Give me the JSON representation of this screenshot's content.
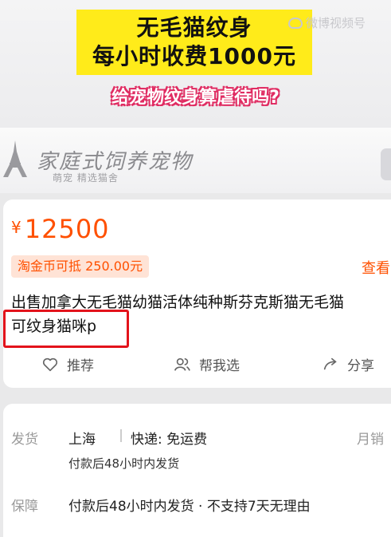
{
  "overlay": {
    "headline_lines": [
      "无毛猫纹身",
      "每小时收费1000元"
    ],
    "subheadline": "给宠物纹身算虐待吗?",
    "watermark": "微博视频号"
  },
  "shop_banner": {
    "title": "家庭式饲养宠物",
    "subtitle": "萌宠 精选猫舍"
  },
  "product": {
    "currency": "¥",
    "price": "12500",
    "coin_deduction": "淘金币可抵 250.00元",
    "view_link": "查看",
    "title_lines": [
      "出售加拿大无毛猫幼猫活体纯种斯芬克斯猫无毛猫",
      "可纹身猫咪p"
    ]
  },
  "actions": {
    "recommend": "推荐",
    "help_choose": "帮我选",
    "share": "分享"
  },
  "shipping": {
    "label": "发货",
    "from": "上海",
    "express": "快递: 免运费",
    "monthly_sales_label": "月销",
    "dispatch_note": "付款后48小时内发货"
  },
  "guarantee": {
    "label": "保障",
    "text": "付款后48小时内发货 · 不支持7天无理由"
  },
  "colors": {
    "price": "#ff5000",
    "headline_bg": "#ffeb1a",
    "subhead_stroke": "#e02d63",
    "highlight_box": "#e3131b"
  }
}
